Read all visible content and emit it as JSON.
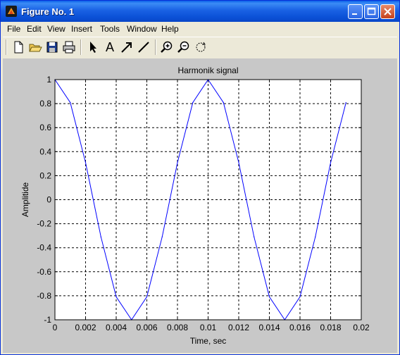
{
  "window": {
    "title": "Figure No. 1",
    "icon": "matlab-logo-icon"
  },
  "menu": [
    {
      "label": "File"
    },
    {
      "label": "Edit"
    },
    {
      "label": "View"
    },
    {
      "label": "Insert"
    },
    {
      "label": "Tools"
    },
    {
      "label": "Window"
    },
    {
      "label": "Help"
    }
  ],
  "toolbar": {
    "tools": [
      "new-file-icon",
      "open-folder-icon",
      "save-icon",
      "print-icon",
      "select-arrow-icon",
      "insert-text-icon",
      "insert-arrow-icon",
      "insert-line-icon",
      "zoom-in-icon",
      "zoom-out-icon",
      "rotate-icon"
    ],
    "text_tool_label": "A"
  },
  "chart_data": {
    "type": "line",
    "title": "Harmonik signal",
    "xlabel": "Time, sec",
    "ylabel": "Amplitide",
    "xlim": [
      0,
      0.02
    ],
    "ylim": [
      -1,
      1
    ],
    "grid": true,
    "xticks": [
      "0",
      "0.002",
      "0.004",
      "0.006",
      "0.008",
      "0.01",
      "0.012",
      "0.014",
      "0.016",
      "0.018",
      "0.02"
    ],
    "yticks": [
      "1",
      "0.8",
      "0.6",
      "0.4",
      "0.2",
      "0",
      "-0.2",
      "-0.4",
      "-0.6",
      "-0.8",
      "-1"
    ],
    "line_color": "#0000ff",
    "series": [
      {
        "x": [
          0,
          0.001,
          0.002,
          0.003,
          0.004,
          0.005,
          0.006,
          0.007,
          0.008,
          0.009,
          0.01,
          0.011,
          0.012,
          0.013,
          0.014,
          0.015,
          0.016,
          0.017,
          0.018,
          0.019
        ],
        "values": [
          1,
          0.809,
          0.309,
          -0.309,
          -0.809,
          -1,
          -0.809,
          -0.309,
          0.309,
          0.809,
          1,
          0.809,
          0.309,
          -0.309,
          -0.809,
          -1,
          -0.809,
          -0.309,
          0.309,
          0.809
        ]
      }
    ]
  }
}
